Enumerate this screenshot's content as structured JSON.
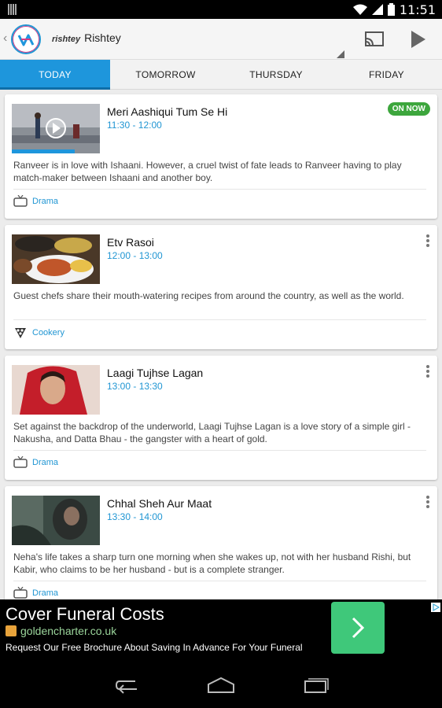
{
  "status": {
    "time": "11:51"
  },
  "app": {
    "channel_brand": "rishtey",
    "channel_name": "Rishtey"
  },
  "tabs": [
    {
      "label": "TODAY",
      "active": true
    },
    {
      "label": "TOMORROW",
      "active": false
    },
    {
      "label": "THURSDAY",
      "active": false
    },
    {
      "label": "FRIDAY",
      "active": false
    }
  ],
  "programs": [
    {
      "title": "Meri Aashiqui Tum Se Hi",
      "time": "11:30 - 12:00",
      "description": "Ranveer is in love with Ishaani. However, a cruel twist of fate leads to Ranveer having to play match-maker between Ishaani and another boy.",
      "genre": "Drama",
      "badge": "ON NOW",
      "progress": 0.7,
      "genre_icon": "tv-icon"
    },
    {
      "title": "Etv Rasoi",
      "time": "12:00 - 13:00",
      "description": "Guest chefs share their mouth-watering recipes from around the country, as well as the world.",
      "genre": "Cookery",
      "genre_icon": "chef-hat-icon"
    },
    {
      "title": "Laagi Tujhse Lagan",
      "time": "13:00 - 13:30",
      "description": "Set against the backdrop of the underworld, Laagi Tujhse Lagan is a love story of a simple girl - Nakusha, and Datta Bhau - the gangster with a heart of gold.",
      "genre": "Drama",
      "genre_icon": "tv-icon"
    },
    {
      "title": "Chhal Sheh Aur Maat",
      "time": "13:30 - 14:00",
      "description": "Neha's life takes a sharp turn one morning when she wakes up, not with her husband Rishi, but Kabir, who claims to be her husband - but is a complete stranger.",
      "genre": "Drama",
      "genre_icon": "tv-icon"
    }
  ],
  "ad": {
    "title": "Cover Funeral Costs",
    "url": "goldencharter.co.uk",
    "body": "Request Our Free Brochure About Saving In Advance For Your Funeral"
  },
  "colors": {
    "accent": "#1e96dc",
    "on_now": "#3da63d",
    "ad_cta": "#3fc87a"
  }
}
